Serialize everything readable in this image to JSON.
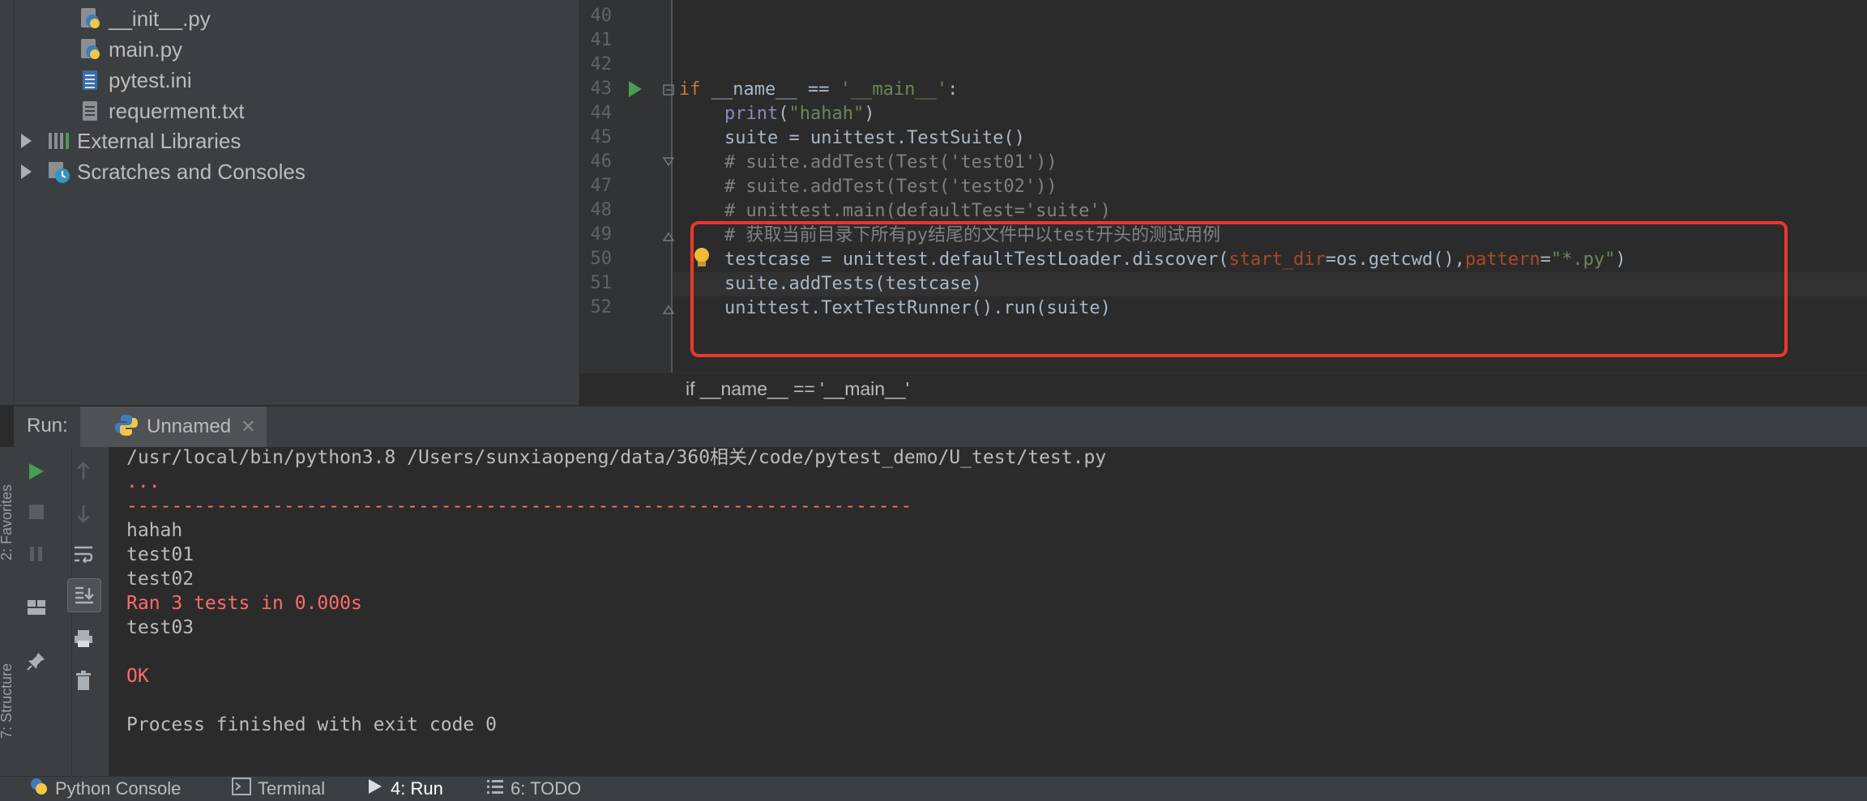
{
  "project_tree": {
    "items": [
      {
        "label": "__init__.py",
        "icon": "python-file-icon"
      },
      {
        "label": "main.py",
        "icon": "python-file-icon"
      },
      {
        "label": "pytest.ini",
        "icon": "ini-file-icon"
      },
      {
        "label": "requerment.txt",
        "icon": "text-file-icon"
      },
      {
        "label": "External Libraries",
        "icon": "libraries-icon"
      },
      {
        "label": "Scratches and Consoles",
        "icon": "scratches-icon"
      }
    ]
  },
  "editor": {
    "line_numbers": [
      "40",
      "41",
      "42",
      "43",
      "44",
      "45",
      "46",
      "47",
      "48",
      "49",
      "50",
      "51",
      "52"
    ],
    "lines": {
      "l43_kw": "if",
      "l43_a": " __name__ == ",
      "l43_str": "'__main__'",
      "l43_b": ":",
      "l44_bi": "print",
      "l44_a": "(",
      "l44_str": "\"hahah\"",
      "l44_b": ")",
      "l45": "suite = unittest.TestSuite()",
      "l46": "# suite.addTest(Test('test01'))",
      "l47": "# suite.addTest(Test('test02'))",
      "l48": "# unittest.main(defaultTest='suite')",
      "l49": "# 获取当前目录下所有py结尾的文件中以test开头的测试用例",
      "l50_a": "testcase = unittest.defaultTestLoader.discover(",
      "l50_p1": "start_dir",
      "l50_b": "=os.getcwd(),",
      "l50_p2": "pattern",
      "l50_c": "=",
      "l50_str": "\"*.py\"",
      "l50_d": ")",
      "l51": "suite.addTests(testcase)",
      "l52": "unittest.TextTestRunner().run(suite)"
    },
    "breadcrumb": "if __name__ == '__main__'"
  },
  "run_panel": {
    "label": "Run:",
    "tab": "Unnamed",
    "output": [
      {
        "text": "/usr/local/bin/python3.8 /Users/sunxiaopeng/data/360相关/code/pytest_demo/U_test/test.py",
        "err": false
      },
      {
        "text": "...",
        "err": true
      },
      {
        "text": "----------------------------------------------------------------------",
        "err": true
      },
      {
        "text": "hahah",
        "err": false
      },
      {
        "text": "test01",
        "err": false
      },
      {
        "text": "test02",
        "err": false
      },
      {
        "text": "Ran 3 tests in 0.000s",
        "err": true
      },
      {
        "text": "test03",
        "err": false
      },
      {
        "text": "",
        "err": false
      },
      {
        "text": "OK",
        "err": true
      },
      {
        "text": "",
        "err": false
      },
      {
        "text": "Process finished with exit code 0",
        "err": false
      }
    ]
  },
  "side_tools": {
    "favorites": "2: Favorites",
    "structure": "7: Structure"
  },
  "status_bar": {
    "python_console": "Python Console",
    "terminal": "Terminal",
    "run": "4: Run",
    "todo": "6: TODO"
  },
  "colors": {
    "highlight_box": "#e8382e",
    "error_text": "#ff6b68",
    "run_green": "#499c54"
  }
}
